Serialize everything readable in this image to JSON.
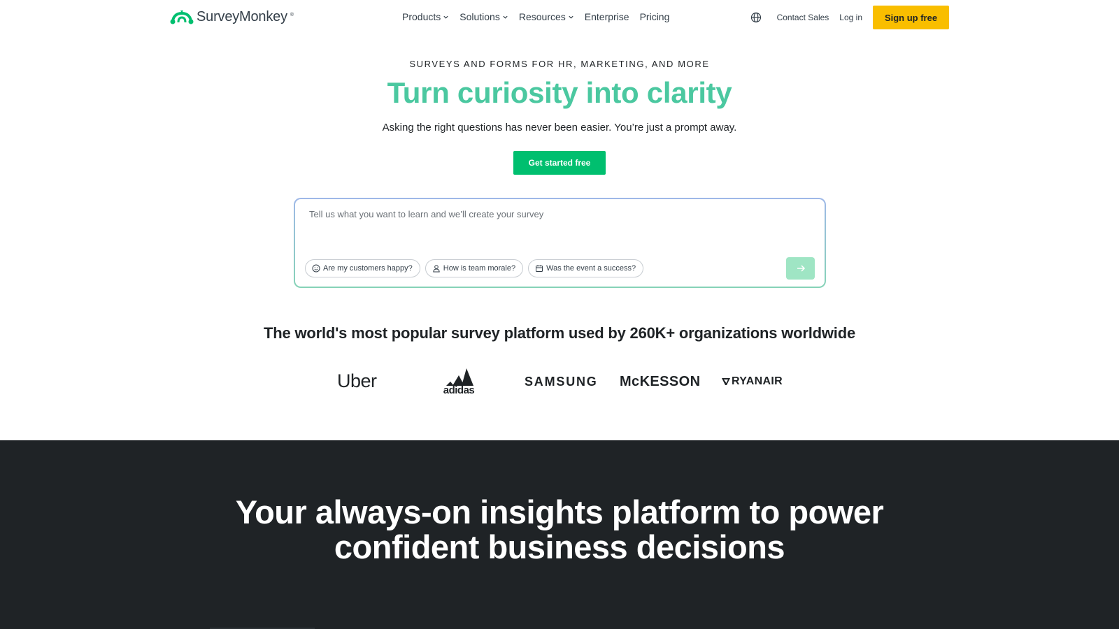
{
  "nav": {
    "logo_text": "SurveyMonkey",
    "logo_reg": "®",
    "links": [
      {
        "label": "Products",
        "dropdown": true
      },
      {
        "label": "Solutions",
        "dropdown": true
      },
      {
        "label": "Resources",
        "dropdown": true
      },
      {
        "label": "Enterprise",
        "dropdown": false
      },
      {
        "label": "Pricing",
        "dropdown": false
      }
    ],
    "language_icon": "globe-icon",
    "contact_sales": "Contact Sales",
    "log_in": "Log in",
    "sign_up": "Sign up free"
  },
  "hero": {
    "eyebrow": "SURVEYS AND FORMS FOR HR, MARKETING, AND MORE",
    "headline": "Turn curiosity into clarity",
    "subline": "Asking the right questions has never been easier. You’re just a prompt away.",
    "cta": "Get started free"
  },
  "prompt": {
    "placeholder": "Tell us what you want to learn and we’ll create your survey",
    "value": "",
    "chips": [
      {
        "label": "Are my customers happy?",
        "icon": "smiley-icon"
      },
      {
        "label": "How is team morale?",
        "icon": "person-icon"
      },
      {
        "label": "Was the event a success?",
        "icon": "calendar-icon"
      }
    ],
    "send_icon": "arrow-right-icon"
  },
  "social_proof": {
    "title": "The world's most popular survey platform used by 260K+ organizations worldwide",
    "logos": [
      "Uber",
      "adidas",
      "SAMSUNG",
      "McKESSON",
      "RYANAIR"
    ]
  },
  "insights": {
    "title_line1": "Your always-on insights platform to power",
    "title_line2": "confident business decisions"
  },
  "colors": {
    "brand_green": "#00bf6f",
    "headline_teal": "#4bc8a0",
    "signup_yellow": "#f9be00",
    "dark_bg": "#1f2326"
  }
}
